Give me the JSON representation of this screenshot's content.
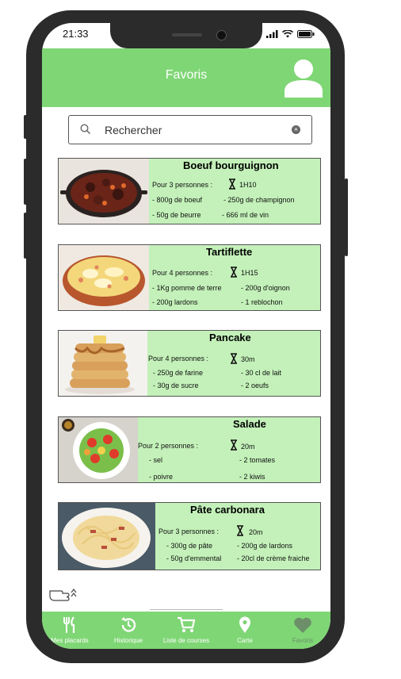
{
  "status_bar": {
    "time": "21:33"
  },
  "header": {
    "title": "Favoris"
  },
  "search": {
    "placeholder": "Rechercher"
  },
  "recipes": [
    {
      "name": "Boeuf bourguignon",
      "people": "Pour 3 personnes :",
      "duration": "1H10",
      "ingredients": [
        "- 800g de boeuf",
        "- 250g de champignon",
        "- 50g de beurre",
        "- 666 ml de vin"
      ]
    },
    {
      "name": "Tartiflette",
      "people": "Pour 4 personnes :",
      "duration": "1H15",
      "ingredients": [
        "- 1Kg pomme de terre",
        "- 200g d'oignon",
        "- 200g lardons",
        "- 1 reblochon"
      ]
    },
    {
      "name": "Pancake",
      "people": "Pour 4 personnes :",
      "duration": "30m",
      "ingredients": [
        "- 250g de farine",
        "- 30 cl de lait",
        "- 30g de sucre",
        "- 2 oeufs"
      ]
    },
    {
      "name": "Salade",
      "people": "Pour 2 personnes :",
      "duration": "20m",
      "ingredients": [
        "- sel",
        "- 2 tomates",
        "- poivre",
        "- 2 kiwis"
      ]
    },
    {
      "name": "Pâte carbonara",
      "people": "Pour 3 personnes :",
      "duration": "20m",
      "ingredients": [
        "- 300g de pâte",
        "- 200g de lardons",
        "- 50g d'emmental",
        "- 20cl de crème fraiche"
      ]
    }
  ],
  "tabs": [
    {
      "label": "Mes placards",
      "icon": "cutlery-icon"
    },
    {
      "label": "Historique",
      "icon": "history-icon"
    },
    {
      "label": "Liste de courses",
      "icon": "cart-icon"
    },
    {
      "label": "Carte",
      "icon": "map-pin-icon"
    },
    {
      "label": "Favoris",
      "icon": "heart-icon",
      "active": true
    }
  ],
  "colors": {
    "accent": "#7fd675",
    "card": "#c3f1b9",
    "active_tab": "#6c8f6a"
  }
}
